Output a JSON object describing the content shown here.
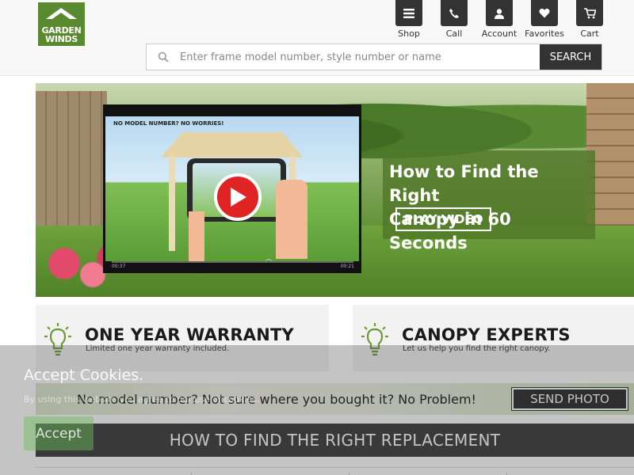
{
  "brand": {
    "logo_line1": "GARDEN",
    "logo_line2": "WINDS"
  },
  "nav": {
    "items": [
      {
        "label": "Shop",
        "icon": "menu-icon"
      },
      {
        "label": "Call",
        "icon": "phone-icon"
      },
      {
        "label": "Account",
        "icon": "user-icon"
      },
      {
        "label": "Favorites",
        "icon": "heart-icon"
      },
      {
        "label": "Cart",
        "icon": "cart-icon"
      }
    ]
  },
  "search": {
    "placeholder": "Enter frame model number, style number or name",
    "button_label": "SEARCH"
  },
  "hero": {
    "video_caption": "NO MODEL NUMBER? NO WORRIES!",
    "time_elapsed": "00:37",
    "time_total": "00:21",
    "headline_line1": "How to Find the Right",
    "headline_line2": "Canopy in 60 Seconds",
    "cta_label": "PLAY VIDEO"
  },
  "features": [
    {
      "title": "ONE YEAR WARRANTY",
      "subtitle": "Limited one year warranty included."
    },
    {
      "title": "CANOPY EXPERTS",
      "subtitle": "Let us help you find the right canopy."
    }
  ],
  "photo_strip": {
    "text": "No model number? Not sure where you bought it? No Problem!",
    "button_label": "SEND PHOTO"
  },
  "section_bar": {
    "title": "HOW TO FIND THE RIGHT REPLACEMENT"
  },
  "cookie": {
    "title": "Accept Cookies.",
    "description": "By using this website you agree to our use of cookies.",
    "button_label": "Accept"
  },
  "colors": {
    "brand_green": "#5a8a2f",
    "dark": "#333333",
    "play_red": "#e02424"
  }
}
